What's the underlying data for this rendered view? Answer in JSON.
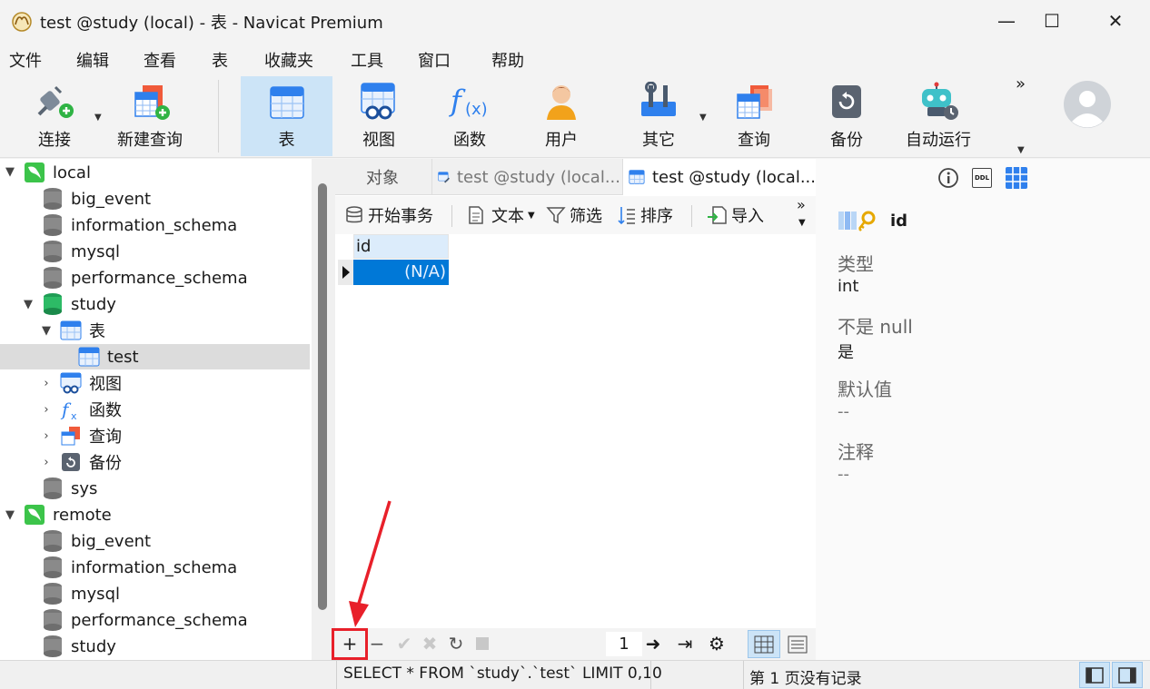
{
  "window": {
    "title": "test @study (local) - 表 - Navicat Premium",
    "minimize": "—",
    "maximize": "☐",
    "close": "✕"
  },
  "menu": [
    "文件",
    "编辑",
    "查看",
    "表",
    "收藏夹",
    "工具",
    "窗口",
    "帮助"
  ],
  "toolbar": {
    "connect": "连接",
    "new_query": "新建查询",
    "table": "表",
    "view": "视图",
    "function": "函数",
    "user": "用户",
    "other": "其它",
    "query": "查询",
    "backup": "备份",
    "automation": "自动运行",
    "more": "»"
  },
  "tree": {
    "local": "local",
    "local_items": [
      "big_event",
      "information_schema",
      "mysql",
      "performance_schema"
    ],
    "study": "study",
    "tables_group": "表",
    "test_table": "test",
    "views_group": "视图",
    "functions_group": "函数",
    "queries_group": "查询",
    "backups_group": "备份",
    "sys": "sys",
    "remote": "remote",
    "remote_items": [
      "big_event",
      "information_schema",
      "mysql",
      "performance_schema",
      "study"
    ]
  },
  "tabs": {
    "objects": "对象",
    "tab1": "test @study (local...",
    "tab2": "test @study (local..."
  },
  "subtoolbar": {
    "begin_tx": "开始事务",
    "text": "文本",
    "filter": "筛选",
    "sort": "排序",
    "import": "导入",
    "more": "»"
  },
  "grid": {
    "columns": [
      "id"
    ],
    "row_value": "(N/A)"
  },
  "bottom": {
    "page": "1"
  },
  "properties": {
    "field_name": "id",
    "type_label": "类型",
    "type_value": "int",
    "notnull_label": "不是 null",
    "notnull_value": "是",
    "default_label": "默认值",
    "default_value": "--",
    "comment_label": "注释",
    "comment_value": "--",
    "ddl_icon_text": "DDL"
  },
  "status": {
    "sql": "SELECT * FROM `study`.`test` LIMIT 0,10",
    "page_info": "第 1 页没有记录"
  },
  "colors": {
    "accent": "#0078d7",
    "selection_bg": "#cce4f7",
    "annotation": "#e8202a"
  }
}
